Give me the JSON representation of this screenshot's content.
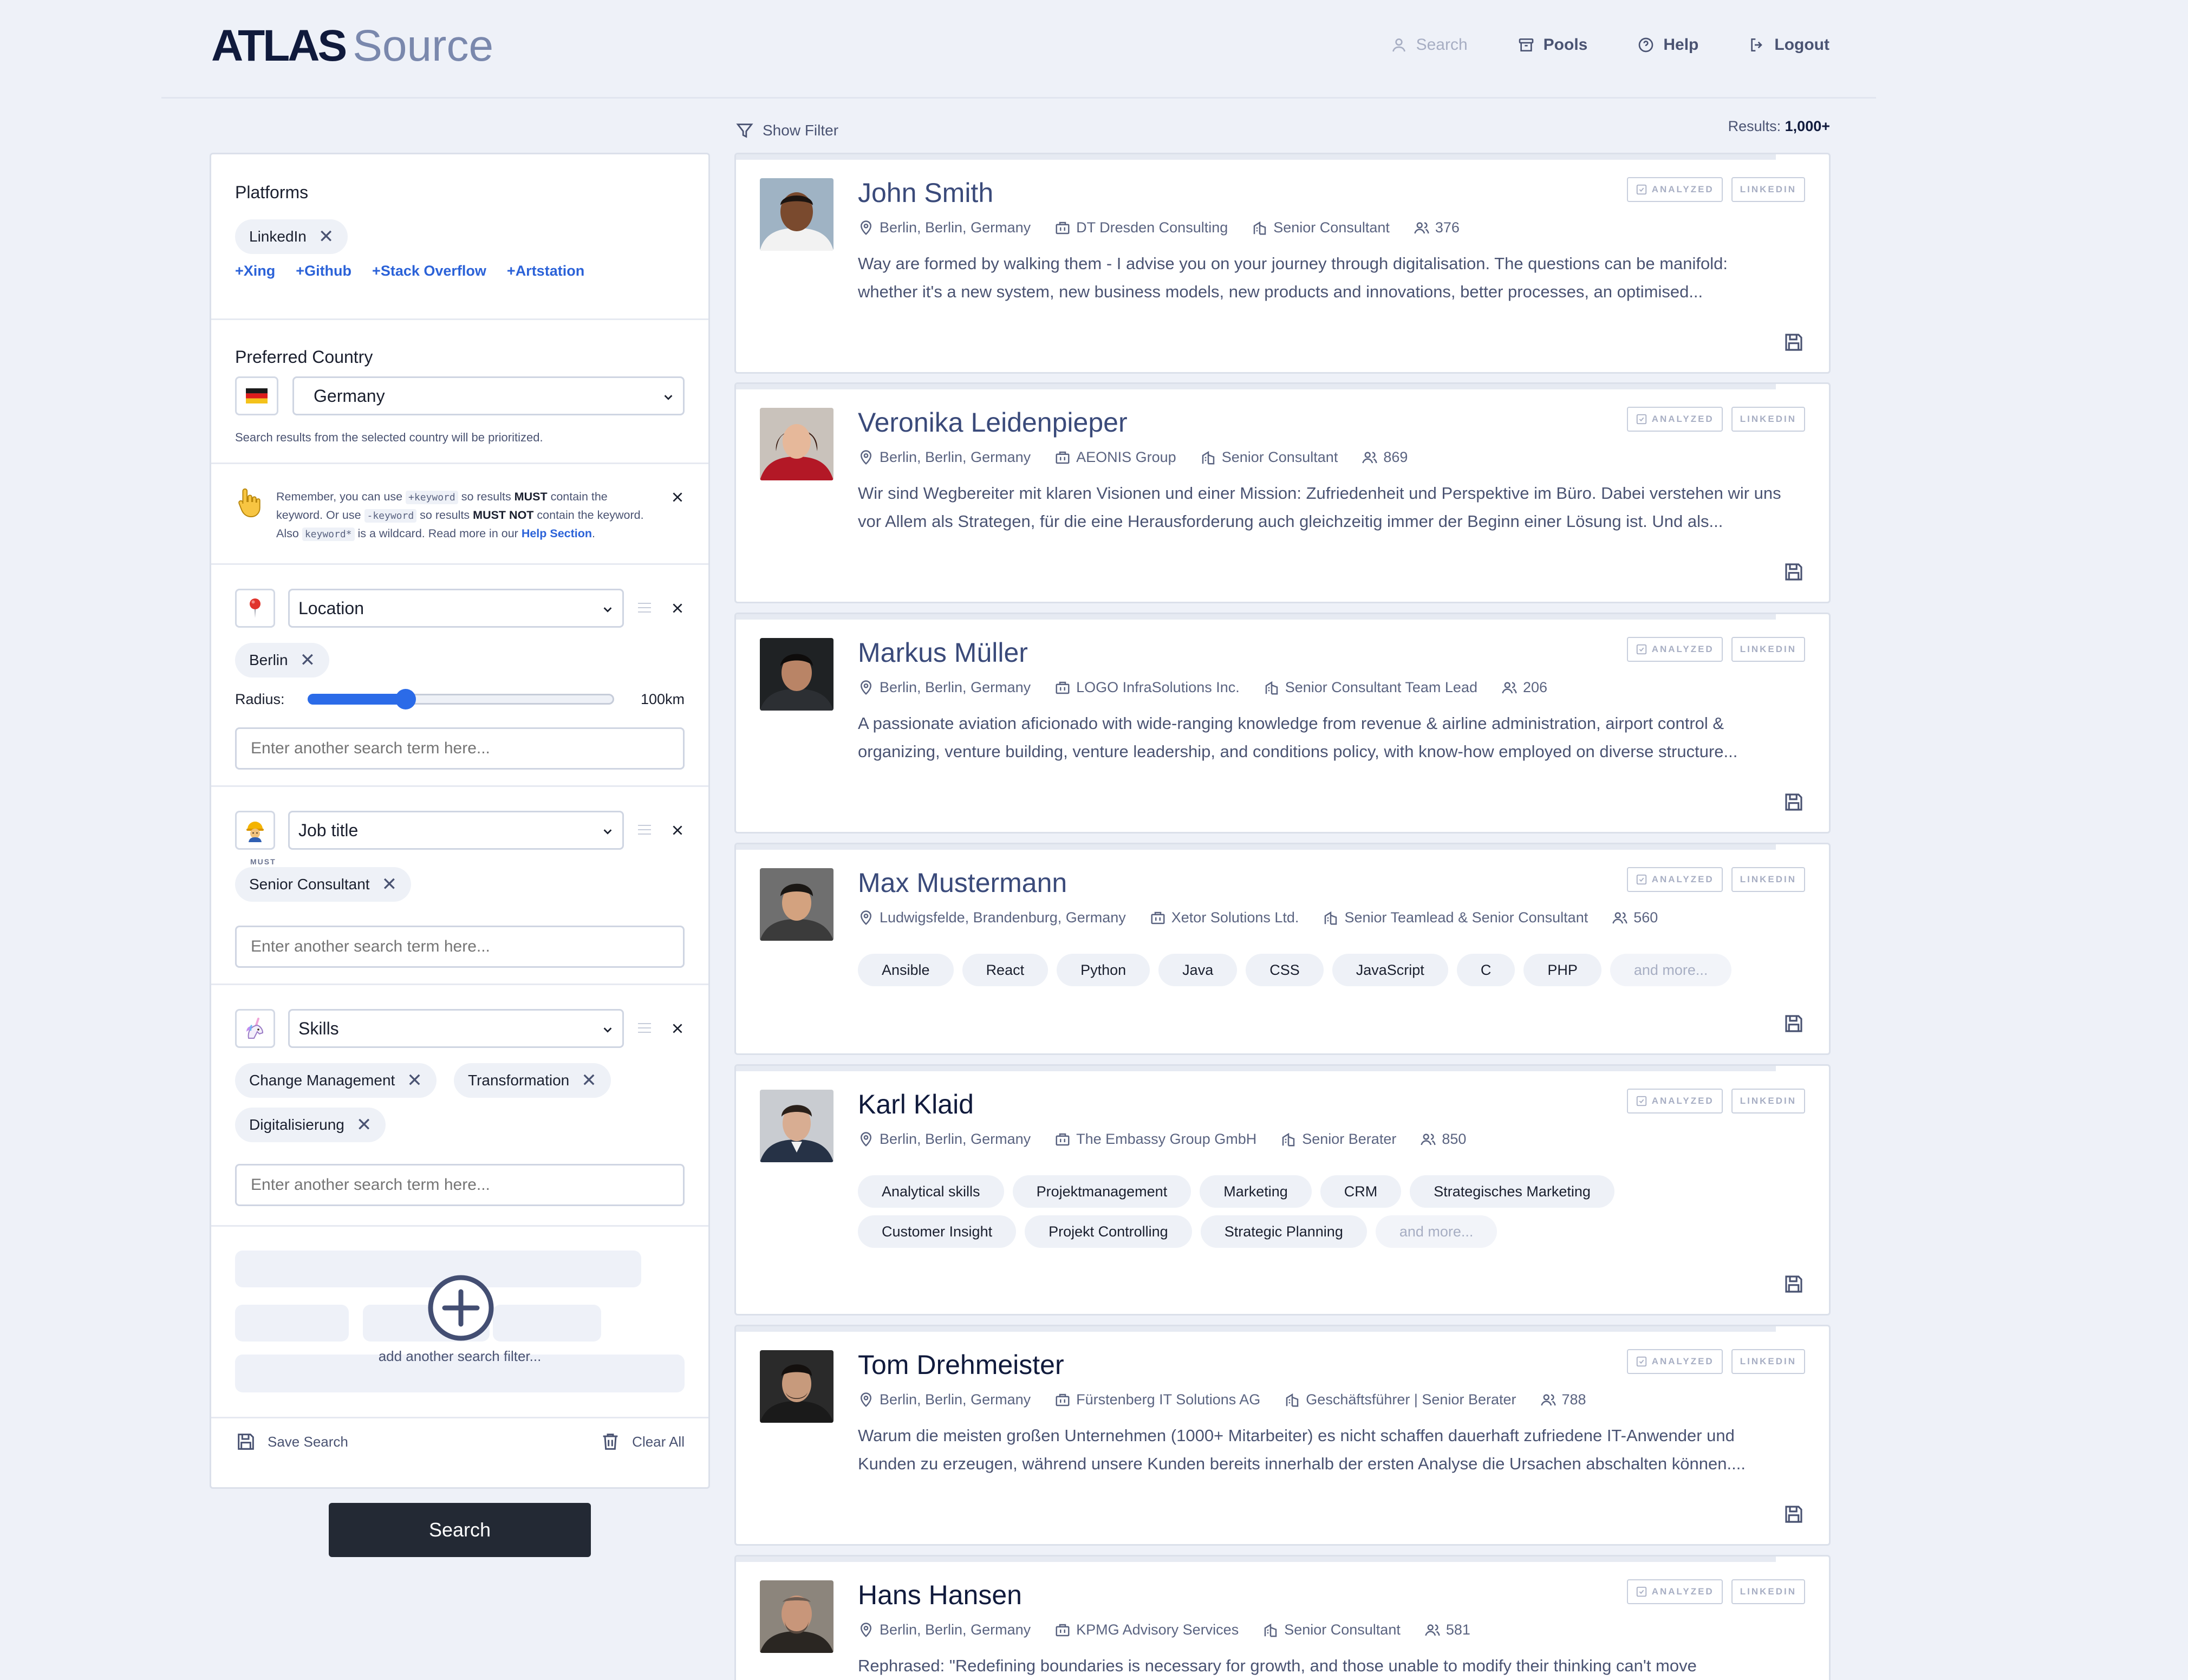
{
  "header": {
    "logo_bold": "ATLAS",
    "logo_light": "Source",
    "nav": {
      "search": "Search",
      "pools": "Pools",
      "help": "Help",
      "logout": "Logout"
    }
  },
  "sidebar": {
    "platforms": {
      "title": "Platforms",
      "selected": "LinkedIn",
      "add_prefix": "+",
      "options": [
        "Xing",
        "Github",
        "Stack Overflow",
        "Artstation"
      ]
    },
    "country": {
      "title": "Preferred Country",
      "flag_icon": "germany-flag-icon",
      "value": "Germany",
      "hint": "Search results from the selected country will be prioritized."
    },
    "reminder": {
      "icon": "pointing-up-hand-icon",
      "p1": "Remember, you can use ",
      "code1": "+keyword",
      "p2": " so results ",
      "b1": "MUST",
      "p3": " contain the keyword. Or use ",
      "code2": "-keyword",
      "p4": " so results ",
      "b2": "MUST NOT",
      "p5": " contain the keyword. Also ",
      "code3": "keyword*",
      "p6": " is a wildcard. Read more in our ",
      "link": "Help Section",
      "p7": "."
    },
    "location": {
      "icon": "pin-icon",
      "field": "Location",
      "chip": "Berlin",
      "radius_label": "Radius:",
      "radius_fraction": 0.32,
      "radius_value": "100km",
      "placeholder": "Enter another search term here..."
    },
    "jobtitle": {
      "icon": "worker-icon",
      "field": "Job title",
      "must_label": "MUST",
      "chip": "Senior Consultant",
      "placeholder": "Enter another search term here..."
    },
    "skills": {
      "icon": "unicorn-icon",
      "field": "Skills",
      "chips": [
        "Change Management",
        "Transformation",
        "Digitalisierung"
      ],
      "placeholder": "Enter another search term here..."
    },
    "add_filter": "add another search filter...",
    "save_search": "Save Search",
    "clear_all": "Clear All",
    "search_button": "Search"
  },
  "results": {
    "show_filter": "Show Filter",
    "count_label": "Results:",
    "count_value": "1,000+",
    "badge_analyzed": "ANALYZED",
    "badge_linkedin": "LINKEDIN",
    "cards": [
      {
        "name": "John Smith",
        "location": "Berlin, Berlin, Germany",
        "company": "DT Dresden Consulting",
        "title": "Senior Consultant",
        "connections": "376",
        "desc": "Way are formed by walking them - I advise you on your journey through digitalisation. The questions can be manifold: whether it's a new system, new business models, new products and innovations, better processes, an optimised..."
      },
      {
        "name": "Veronika Leidenpieper",
        "location": "Berlin, Berlin, Germany",
        "company": "AEONIS Group",
        "title": "Senior Consultant",
        "connections": "869",
        "desc": "Wir sind Wegbereiter mit klaren Visionen und einer Mission: Zufriedenheit und Perspektive im Büro. Dabei verstehen wir uns vor Allem als Strategen, für die eine Herausforderung auch gleichzeitig immer der Beginn einer Lösung ist. Und als..."
      },
      {
        "name": "Markus Müller",
        "location": "Berlin, Berlin, Germany",
        "company": "LOGO InfraSolutions Inc.",
        "title": "Senior Consultant Team Lead",
        "connections": "206",
        "desc": "A passionate aviation aficionado with wide-ranging knowledge from revenue & airline administration, airport control & organizing, venture building, venture leadership, and conditions policy, with know-how employed on diverse structure..."
      },
      {
        "name": "Max Mustermann",
        "location": "Ludwigsfelde, Brandenburg, Germany",
        "company": "Xetor Solutions Ltd.",
        "title": "Senior Teamlead & Senior Consultant",
        "connections": "560",
        "skills": [
          "Ansible",
          "React",
          "Python",
          "Java",
          "CSS",
          "JavaScript",
          "C",
          "PHP"
        ],
        "more": "and more..."
      },
      {
        "name": "Karl Klaid",
        "location": "Berlin, Berlin, Germany",
        "company": "The Embassy Group GmbH",
        "title": "Senior Berater",
        "connections": "850",
        "skills": [
          "Analytical skills",
          "Projektmanagement",
          "Marketing",
          "CRM",
          "Strategisches Marketing",
          "Customer Insight",
          "Projekt Controlling",
          "Strategic Planning"
        ],
        "more": "and more..."
      },
      {
        "name": "Tom Drehmeister",
        "location": "Berlin, Berlin, Germany",
        "company": "Fürstenberg IT Solutions AG",
        "title": "Geschäftsführer | Senior Berater",
        "connections": "788",
        "desc": "Warum die meisten großen Unternehmen (1000+ Mitarbeiter) es nicht schaffen dauerhaft zufriedene IT-Anwender und Kunden zu erzeugen, während unsere Kunden bereits innerhalb der ersten Analyse die Ursachen abschalten können...."
      },
      {
        "name": "Hans Hansen",
        "location": "Berlin, Berlin, Germany",
        "company": "KPMG Advisory Services",
        "title": "Senior Consultant",
        "connections": "581",
        "desc": "Rephrased: \"Redefining boundaries is necessary for growth, and those unable to modify their thinking can't move"
      }
    ]
  }
}
